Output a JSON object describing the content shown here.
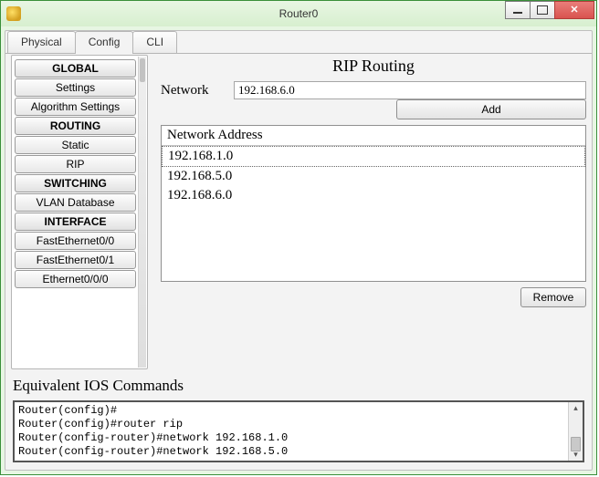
{
  "window": {
    "title": "Router0"
  },
  "tabs": {
    "physical": "Physical",
    "config": "Config",
    "cli": "CLI"
  },
  "sidebar": {
    "global_header": "GLOBAL",
    "settings": "Settings",
    "algorithm_settings": "Algorithm Settings",
    "routing_header": "ROUTING",
    "static": "Static",
    "rip": "RIP",
    "switching_header": "SWITCHING",
    "vlan_db": "VLAN Database",
    "interface_header": "INTERFACE",
    "fe00": "FastEthernet0/0",
    "fe01": "FastEthernet0/1",
    "eth000": "Ethernet0/0/0"
  },
  "panel": {
    "title": "RIP Routing",
    "network_label": "Network",
    "network_value": "192.168.6.0",
    "add_label": "Add",
    "list_header": "Network Address",
    "rows": {
      "r0": "192.168.1.0",
      "r1": "192.168.5.0",
      "r2": "192.168.6.0"
    },
    "remove_label": "Remove"
  },
  "ios": {
    "label": "Equivalent IOS Commands",
    "lines": {
      "l0": "Router(config)#",
      "l1": "Router(config)#router rip",
      "l2": "Router(config-router)#network 192.168.1.0",
      "l3": "Router(config-router)#network 192.168.5.0"
    }
  }
}
